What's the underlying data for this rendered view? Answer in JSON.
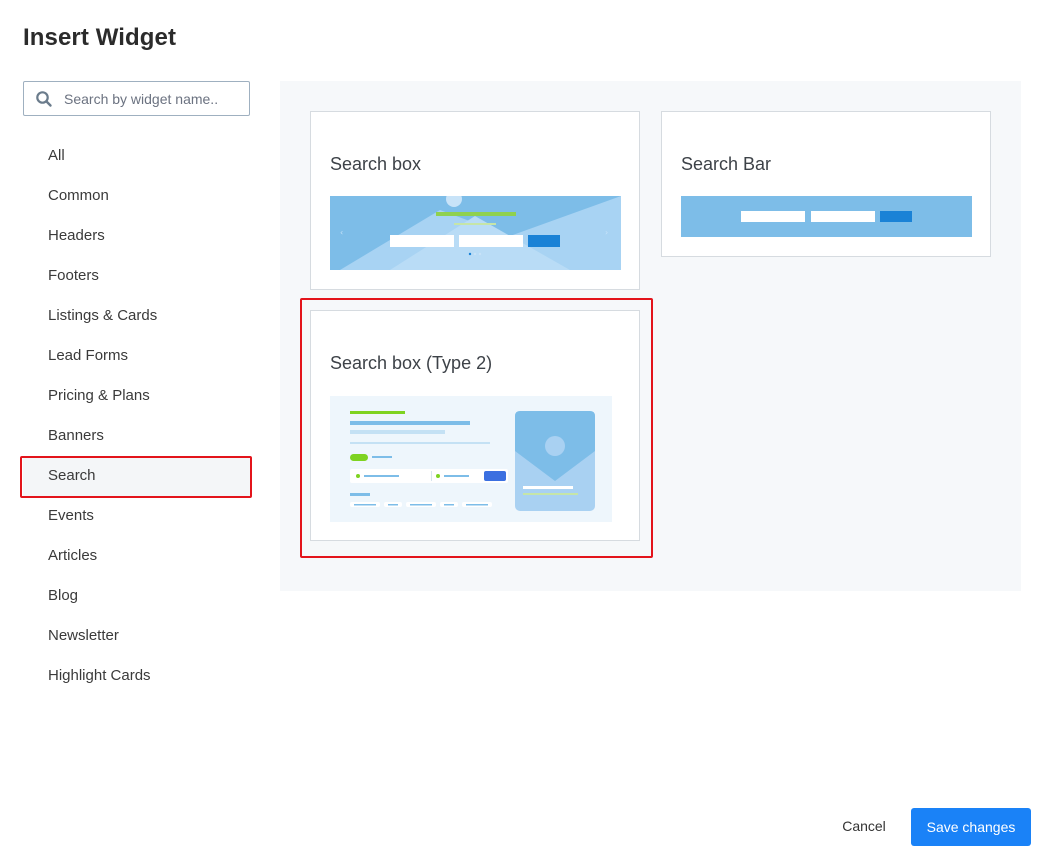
{
  "dialog": {
    "title": "Insert Widget"
  },
  "search": {
    "placeholder": "Search by widget name.."
  },
  "categories": [
    {
      "label": "All"
    },
    {
      "label": "Common"
    },
    {
      "label": "Headers"
    },
    {
      "label": "Footers"
    },
    {
      "label": "Listings & Cards"
    },
    {
      "label": "Lead Forms"
    },
    {
      "label": "Pricing & Plans"
    },
    {
      "label": "Banners"
    },
    {
      "label": "Search"
    },
    {
      "label": "Events"
    },
    {
      "label": "Articles"
    },
    {
      "label": "Blog"
    },
    {
      "label": "Newsletter"
    },
    {
      "label": "Highlight Cards"
    }
  ],
  "selected_category": "Search",
  "widgets": [
    {
      "title": "Search box"
    },
    {
      "title": "Search Bar"
    },
    {
      "title": "Search box (Type 2)"
    }
  ],
  "footer": {
    "cancel_label": "Cancel",
    "save_label": "Save changes"
  },
  "colors": {
    "accent": "#1a82f7",
    "highlight": "#e3141b",
    "thumb_blue": "#7dbde8",
    "thumb_green": "#7ed321"
  }
}
